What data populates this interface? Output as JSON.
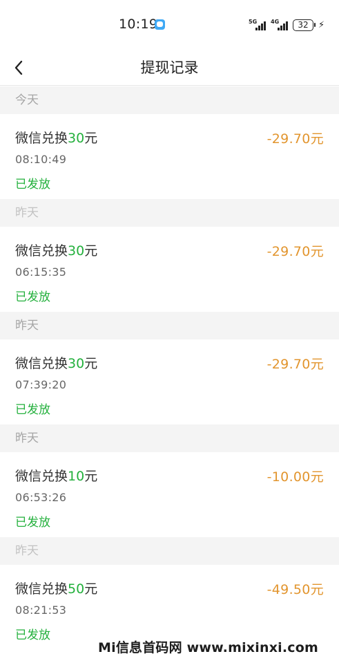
{
  "status_bar": {
    "time": "10:19",
    "network_1": "5G",
    "network_2": "4G",
    "battery": "32"
  },
  "nav": {
    "title": "提现记录"
  },
  "groups": [
    {
      "date_label": "今天",
      "item": {
        "title_prefix": "微信兑换",
        "amount": "30",
        "title_suffix": "元",
        "time": "08:10:49",
        "status": "已发放",
        "value": "-29.70元"
      }
    },
    {
      "date_label": "昨天",
      "item": {
        "title_prefix": "微信兑换",
        "amount": "30",
        "title_suffix": "元",
        "time": "06:15:35",
        "status": "已发放",
        "value": "-29.70元"
      }
    },
    {
      "date_label": "昨天",
      "item": {
        "title_prefix": "微信兑换",
        "amount": "30",
        "title_suffix": "元",
        "time": "07:39:20",
        "status": "已发放",
        "value": "-29.70元"
      }
    },
    {
      "date_label": "昨天",
      "item": {
        "title_prefix": "微信兑换",
        "amount": "10",
        "title_suffix": "元",
        "time": "06:53:26",
        "status": "已发放",
        "value": "-10.00元"
      }
    },
    {
      "date_label": "昨天",
      "item": {
        "title_prefix": "微信兑换",
        "amount": "50",
        "title_suffix": "元",
        "time": "08:21:53",
        "status": "已发放",
        "value": "-49.50元"
      }
    }
  ],
  "colors": {
    "accent_green": "#23b03c",
    "value_orange": "#e2952e",
    "header_bg": "#f4f4f4"
  },
  "watermark": "Mi信息首码网 www.mixinxi.com"
}
